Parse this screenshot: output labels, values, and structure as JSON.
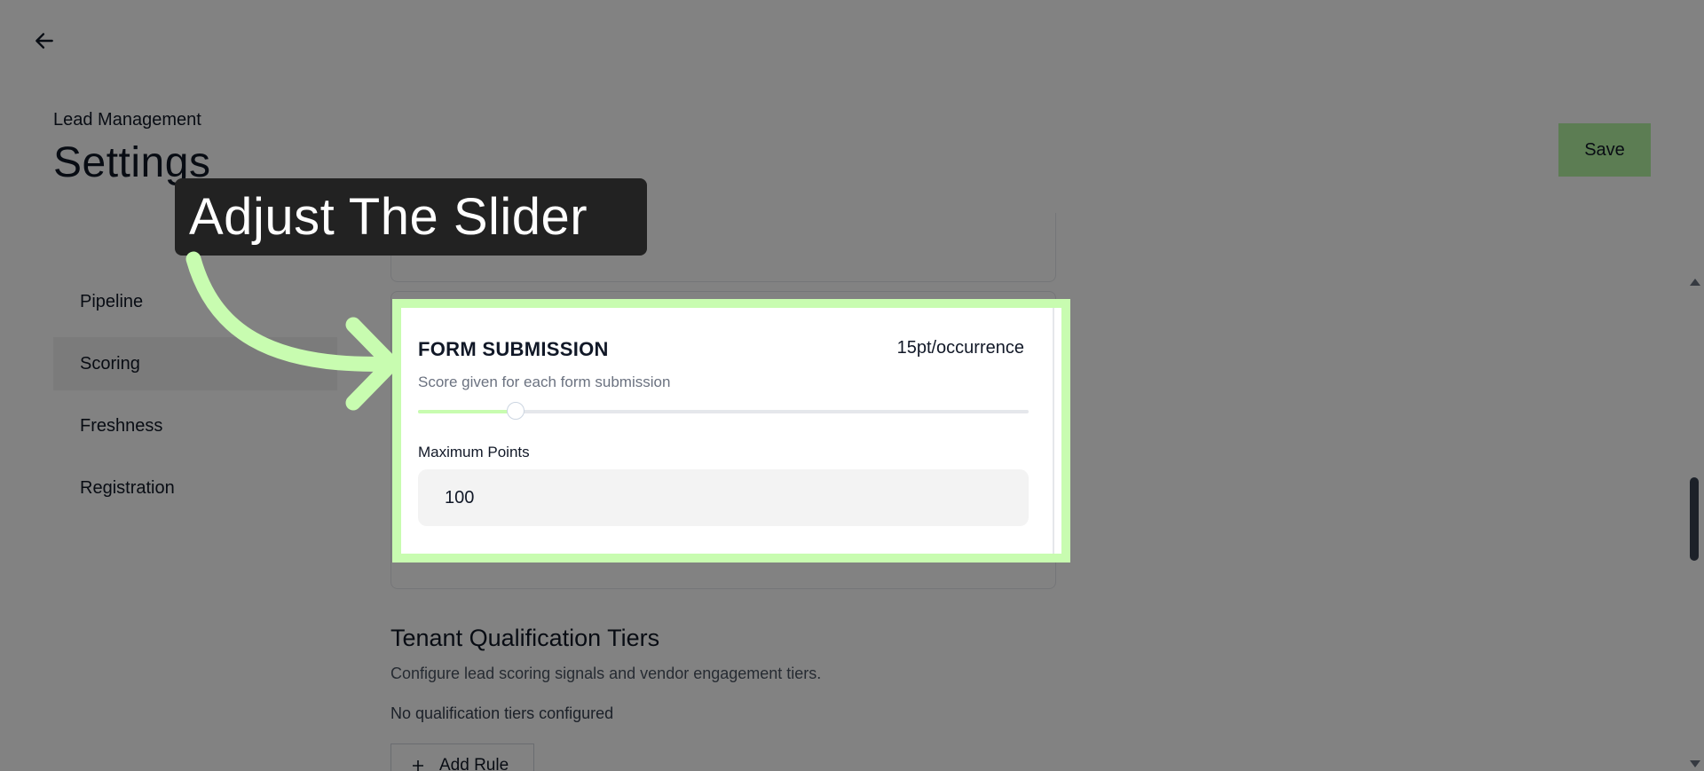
{
  "header": {
    "breadcrumb": "Lead Management",
    "title": "Settings",
    "save_label": "Save"
  },
  "sidebar": {
    "items": [
      {
        "label": "Pipeline",
        "active": false
      },
      {
        "label": "Scoring",
        "active": true
      },
      {
        "label": "Freshness",
        "active": false
      },
      {
        "label": "Registration",
        "active": false
      }
    ]
  },
  "scoring_card": {
    "title": "FORM SUBMISSION",
    "value": "15pt/occurrence",
    "description": "Score given for each form submission",
    "slider_fraction": 0.16,
    "max_points_label": "Maximum Points",
    "max_points_value": "100"
  },
  "tiers": {
    "title": "Tenant Qualification Tiers",
    "description": "Configure lead scoring signals and vendor engagement tiers.",
    "empty_message": "No qualification tiers configured",
    "add_rule_label": "Add Rule"
  },
  "callout": {
    "text": "Adjust The Slider"
  },
  "colors": {
    "accent": "#c8fcb0",
    "save_bg": "#b5f5a4",
    "callout_bg": "#222222"
  },
  "icons": {
    "back": "arrow-left-icon",
    "add": "plus-icon"
  }
}
